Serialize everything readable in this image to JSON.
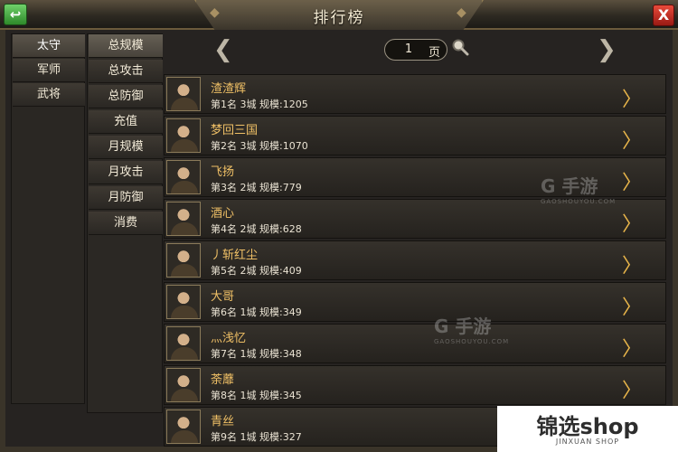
{
  "header": {
    "title": "排行榜",
    "back_icon": "back-arrow-icon",
    "close_label": "X"
  },
  "categories": [
    {
      "label": "太守",
      "active": true
    },
    {
      "label": "军师",
      "active": false
    },
    {
      "label": "武将",
      "active": false
    }
  ],
  "subcategories": [
    {
      "label": "总规模",
      "active": true
    },
    {
      "label": "总攻击",
      "active": false
    },
    {
      "label": "总防御",
      "active": false
    },
    {
      "label": "充值",
      "active": false
    },
    {
      "label": "月规模",
      "active": false
    },
    {
      "label": "月攻击",
      "active": false
    },
    {
      "label": "月防御",
      "active": false
    },
    {
      "label": "消费",
      "active": false
    }
  ],
  "pager": {
    "page": "1",
    "unit": "页"
  },
  "rankings": [
    {
      "name": "渣渣辉",
      "info": "第1名 3城 规模:1205"
    },
    {
      "name": "梦回三国",
      "info": "第2名 3城 规模:1070"
    },
    {
      "name": "飞扬",
      "info": "第3名 2城 规模:779"
    },
    {
      "name": "酒心",
      "info": "第4名 2城 规模:628"
    },
    {
      "name": "丿斩红尘",
      "info": "第5名 2城 规模:409"
    },
    {
      "name": "大哥",
      "info": "第6名 1城 规模:349"
    },
    {
      "name": "灬浅忆",
      "info": "第7名 1城 规模:348"
    },
    {
      "name": "荼蘼",
      "info": "第8名 1城 规模:345"
    },
    {
      "name": "青丝",
      "info": "第9名 1城 规模:327"
    }
  ],
  "watermark": {
    "text": "G 手游",
    "sub": "GAOSHOUYOU.COM"
  },
  "shop_badge": {
    "name": "锦选shop",
    "sub": "JINXUAN SHOP"
  }
}
